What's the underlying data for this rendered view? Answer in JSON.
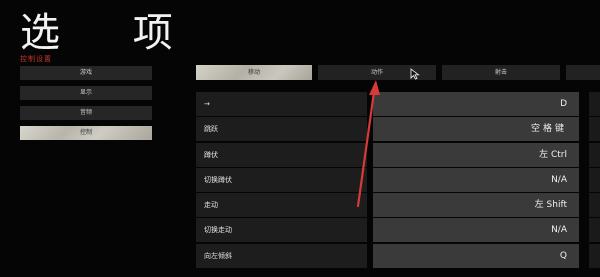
{
  "header": {
    "title": "选 项",
    "subtitle": "控制设置"
  },
  "sidebar": {
    "items": [
      {
        "label": "游戏",
        "active": false
      },
      {
        "label": "显示",
        "active": false
      },
      {
        "label": "音频",
        "active": false
      },
      {
        "label": "控制",
        "active": true
      }
    ]
  },
  "tabs": [
    {
      "label": "移动",
      "active": true
    },
    {
      "label": "动作",
      "active": false
    },
    {
      "label": "射击",
      "active": false
    }
  ],
  "bindings": [
    {
      "label": "→",
      "value": "D"
    },
    {
      "label": "跳跃",
      "value": "空格键"
    },
    {
      "label": "蹲伏",
      "value": "左 Ctrl"
    },
    {
      "label": "切换蹲伏",
      "value": "N/A"
    },
    {
      "label": "走动",
      "value": "左 Shift"
    },
    {
      "label": "切换走动",
      "value": "N/A"
    },
    {
      "label": "向左倾斜",
      "value": "Q"
    }
  ],
  "colors": {
    "accent_red": "#c8352b",
    "annotation_arrow": "#d63a3a"
  }
}
